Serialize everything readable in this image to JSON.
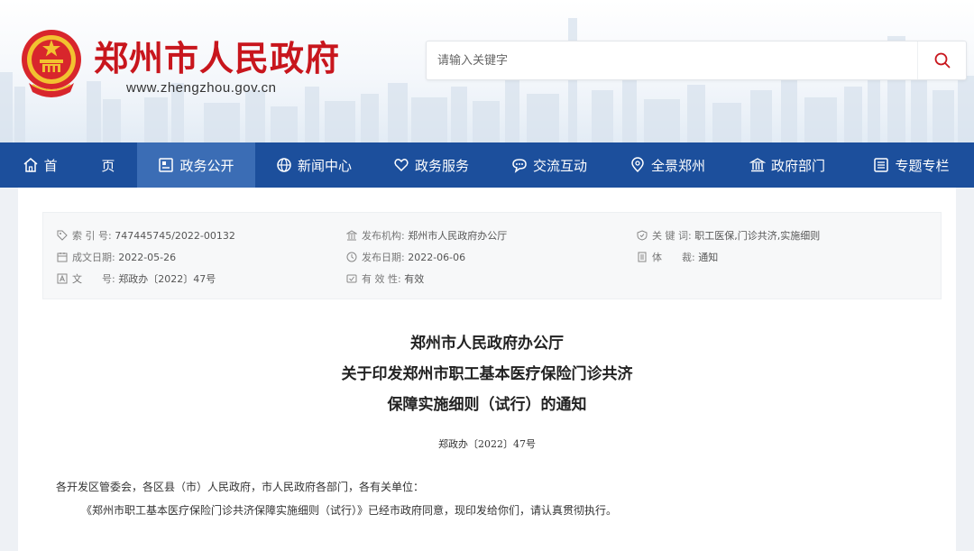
{
  "header": {
    "title": "郑州市人民政府",
    "url": "www.zhengzhou.gov.cn",
    "search_placeholder": "请输入关键字"
  },
  "nav": [
    {
      "label": "首 页",
      "icon": "home-icon"
    },
    {
      "label": "政务公开",
      "icon": "document-list-icon",
      "active": true
    },
    {
      "label": "新闻中心",
      "icon": "globe-icon"
    },
    {
      "label": "政务服务",
      "icon": "heart-icon"
    },
    {
      "label": "交流互动",
      "icon": "chat-bubble-icon"
    },
    {
      "label": "全景郑州",
      "icon": "location-icon"
    },
    {
      "label": "政府部门",
      "icon": "government-building-icon"
    },
    {
      "label": "专题专栏",
      "icon": "list-panel-icon"
    }
  ],
  "meta": {
    "index_label": "索 引 号:",
    "index_value": "747445745/2022-00132",
    "publisher_label": "发布机构:",
    "publisher_value": "郑州市人民政府办公厅",
    "keywords_label": "关 键 词:",
    "keywords_value": "职工医保,门诊共济,实施细则",
    "created_label": "成文日期:",
    "created_value": "2022-05-26",
    "published_label": "发布日期:",
    "published_value": "2022-06-06",
    "category_label": "体　　裁:",
    "category_value": "通知",
    "docno_label": "文　　号:",
    "docno_value": "郑政办〔2022〕47号",
    "validity_label": "有 效 性:",
    "validity_value": "有效"
  },
  "document": {
    "title_line1": "郑州市人民政府办公厅",
    "title_line2": "关于印发郑州市职工基本医疗保险门诊共济",
    "title_line3": "保障实施细则（试行）的通知",
    "number": "郑政办〔2022〕47号",
    "salutation": "各开发区管委会，各区县（市）人民政府，市人民政府各部门，各有关单位：",
    "body": "《郑州市职工基本医疗保险门诊共济保障实施细则（试行）》已经市政府同意，现印发给你们，请认真贯彻执行。"
  },
  "colors": {
    "brand_red": "#c8161d",
    "nav_blue": "#1c4f9c",
    "nav_active": "#3b6db5"
  }
}
